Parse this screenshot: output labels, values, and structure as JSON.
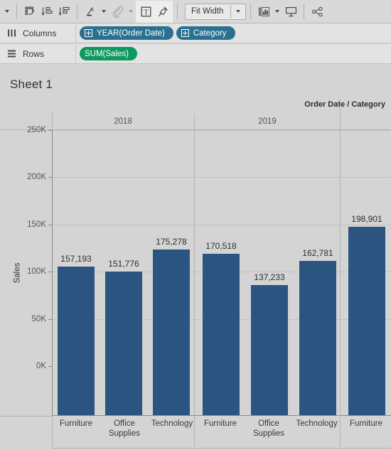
{
  "toolbar": {
    "items": [
      {
        "name": "undo-dropdown-caret",
        "icon": "caret-down-icon"
      },
      {
        "name": "swap-rows-columns-button",
        "icon": "swap-icon"
      },
      {
        "name": "sort-ascending-button",
        "icon": "sort-ascending-icon"
      },
      {
        "name": "sort-descending-button",
        "icon": "sort-descending-icon"
      },
      {
        "name": "highlighter-button",
        "icon": "highlighter-icon"
      },
      {
        "name": "annotate-button",
        "icon": "paperclip-icon"
      },
      {
        "name": "text-box-button",
        "icon": "text-box-icon"
      },
      {
        "name": "pin-button",
        "icon": "pin-icon"
      },
      {
        "name": "show-me-button",
        "icon": "show-me-chart-icon"
      },
      {
        "name": "presentation-mode-button",
        "icon": "presentation-screen-icon"
      },
      {
        "name": "share-button",
        "icon": "share-nodes-icon"
      }
    ],
    "fit_label": "Fit Width"
  },
  "shelves": {
    "columns": {
      "label": "Columns",
      "icon": "columns-icon",
      "pills": [
        {
          "label": "YEAR(Order Date)",
          "color": "#2a7090",
          "expandable": true
        },
        {
          "label": "Category",
          "color": "#2a7090",
          "expandable": true
        }
      ]
    },
    "rows": {
      "label": "Rows",
      "icon": "rows-icon",
      "pills": [
        {
          "label": "SUM(Sales)",
          "color": "#0f9960",
          "expandable": false
        }
      ]
    }
  },
  "sheet": {
    "title": "Sheet 1",
    "header_caption": "Order Date / Category"
  },
  "chart_data": {
    "type": "bar",
    "title": "Sheet 1",
    "xlabel": "Order Date / Category",
    "ylabel": "Sales",
    "ylim": [
      0,
      275000
    ],
    "yticks": [
      0,
      50000,
      100000,
      150000,
      200000,
      250000
    ],
    "ytick_labels": [
      "0K",
      "50K",
      "100K",
      "150K",
      "200K",
      "250K"
    ],
    "grid": true,
    "legend": "none",
    "bar_color": "#2b5580",
    "groups": [
      {
        "year": "2018",
        "bars": [
          {
            "category": "Furniture",
            "value": 157193,
            "label": "157,193"
          },
          {
            "category": "Office Supplies",
            "value": 151776,
            "label": "151,776"
          },
          {
            "category": "Technology",
            "value": 175278,
            "label": "175,278"
          }
        ]
      },
      {
        "year": "2019",
        "bars": [
          {
            "category": "Furniture",
            "value": 170518,
            "label": "170,518"
          },
          {
            "category": "Office Supplies",
            "value": 137233,
            "label": "137,233"
          },
          {
            "category": "Technology",
            "value": 162781,
            "label": "162,781"
          }
        ]
      },
      {
        "year": "",
        "bars": [
          {
            "category": "Furniture",
            "value": 198901,
            "label": "198,901"
          }
        ]
      }
    ]
  }
}
